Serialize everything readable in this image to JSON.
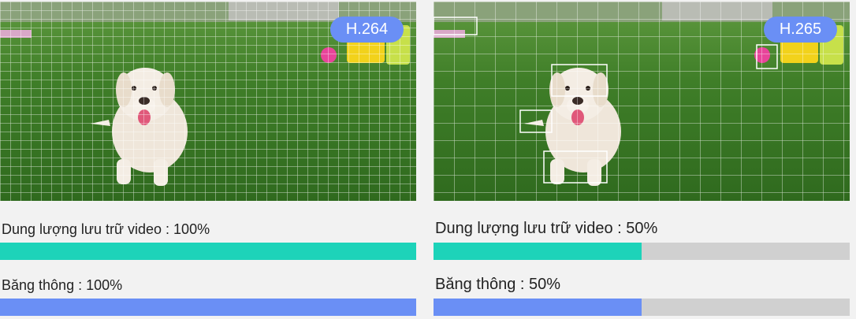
{
  "colors": {
    "storage_bar": "#1dd3b9",
    "bandwidth_bar": "#6a8ff5",
    "bar_track": "#d0d0d0",
    "badge": "#6a8ff5"
  },
  "panels": [
    {
      "codec": "H.264",
      "storage_label": "Dung lượng lưu trữ video : 100%",
      "storage_fraction": 1.0,
      "bandwidth_label": "Băng thông : 100%",
      "bandwidth_fraction": 1.0
    },
    {
      "codec": "H.265",
      "storage_label": "Dung lượng lưu trữ video : 50%",
      "storage_fraction": 0.5,
      "bandwidth_label": "Băng thông : 50%",
      "bandwidth_fraction": 0.5
    }
  ]
}
